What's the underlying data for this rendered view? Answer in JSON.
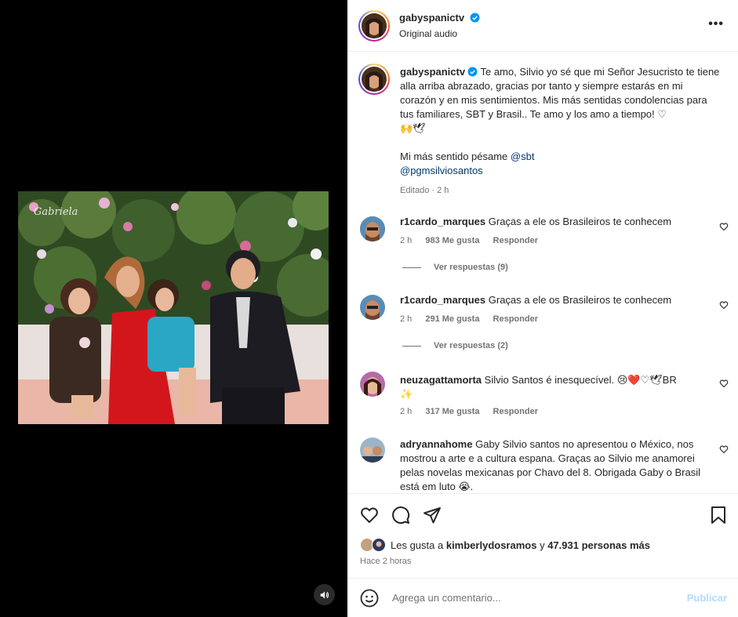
{
  "header": {
    "username": "gabyspanictv",
    "subtitle": "Original audio",
    "more_label": "•••"
  },
  "caption": {
    "username": "gabyspanictv",
    "text": "Te amo, Silvio yo sé que mi Señor Jesucristo te tiene alla arriba abrazado, gracias por tanto y siempre estarás en mi corazón y en mis sentimientos. Mis más sentidas condolencias para tus familiares, SBT y Brasil.. Te amo y los amo a tiempo! ♡",
    "emojis": "🙌🕊",
    "second_line": "Mi más sentido pésame",
    "mention_1": "@sbt",
    "mention_2": "@pgmsilviosantos",
    "edited": "Editado · 2 h"
  },
  "video": {
    "watermark": "Gabriela",
    "mute_icon": "speaker-icon"
  },
  "comments": [
    {
      "username": "r1cardo_marques",
      "text": "Graças a ele os Brasileiros te conhecem",
      "time": "2 h",
      "likes": "983 Me gusta",
      "reply": "Responder",
      "view_replies": "Ver respuestas (9)"
    },
    {
      "username": "r1cardo_marques",
      "text": "Graças a ele os Brasileiros te conhecem",
      "time": "2 h",
      "likes": "291 Me gusta",
      "reply": "Responder",
      "view_replies": "Ver respuestas (2)"
    },
    {
      "username": "neuzagattamorta",
      "text": "Silvio Santos é inesquecível. 😢❤️♡🕊BR",
      "text_line2": "✨",
      "time": "2 h",
      "likes": "317 Me gusta",
      "reply": "Responder"
    },
    {
      "username": "adryannahome",
      "text": "Gaby Silvio santos no apresentou o México, nos mostrou a arte e a cultura espana. Graças ao Silvio me anamorei pelas novelas mexicanas por Chavo del 8. Obrigada Gaby o Brasil está em luto 😭."
    }
  ],
  "likes": {
    "prefix": "Les gusta a",
    "user": "kimberlydosramos",
    "and": "y",
    "others": "47.931 personas más"
  },
  "time_ago": "Hace 2 horas",
  "add_comment": {
    "placeholder": "Agrega un comentario...",
    "publish": "Publicar"
  },
  "colors": {
    "link": "#00376b",
    "verified": "#0095f6",
    "publish": "#b3dbff",
    "secondary": "#737373"
  }
}
